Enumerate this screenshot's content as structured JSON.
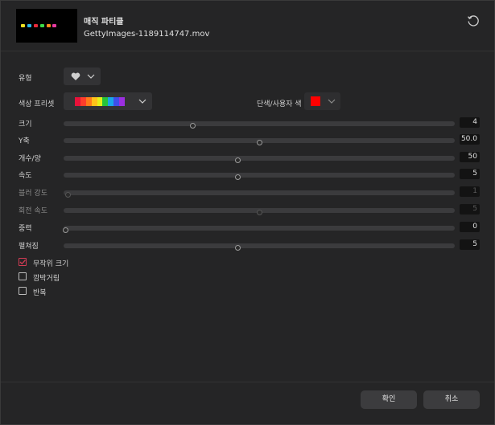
{
  "header": {
    "title": "매직 파티클",
    "filename": "GettyImages-1189114747.mov"
  },
  "type_row": {
    "label": "유형",
    "selected_icon": "heart-icon"
  },
  "preset_row": {
    "label": "색상 프리셋",
    "colors": [
      "#e8123a",
      "#ff3d2b",
      "#ff7a1a",
      "#ffc21a",
      "#e3f01a",
      "#27c43b",
      "#1aa6e8",
      "#3f4fe8",
      "#9b2fe0"
    ],
    "mono_label": "단색/사용자 색",
    "mono_color": "#ff0000"
  },
  "sliders": [
    {
      "label": "크기",
      "value": "4",
      "fraction": 0.33,
      "enabled": true
    },
    {
      "label": "Y축",
      "value": "50.0",
      "fraction": 0.5,
      "enabled": true
    },
    {
      "label": "개수/양",
      "value": "50",
      "fraction": 0.445,
      "enabled": true
    },
    {
      "label": "속도",
      "value": "5",
      "fraction": 0.445,
      "enabled": true
    },
    {
      "label": "블러 강도",
      "value": "1",
      "fraction": 0.01,
      "enabled": false
    },
    {
      "label": "회전 속도",
      "value": "5",
      "fraction": 0.5,
      "enabled": false
    },
    {
      "label": "중력",
      "value": "0",
      "fraction": 0.005,
      "enabled": true
    },
    {
      "label": "펼쳐짐",
      "value": "5",
      "fraction": 0.445,
      "enabled": true
    }
  ],
  "checkboxes": [
    {
      "label": "무작위 크기",
      "checked": true
    },
    {
      "label": "깜박거림",
      "checked": false
    },
    {
      "label": "반복",
      "checked": false
    }
  ],
  "footer": {
    "ok_label": "확인",
    "cancel_label": "취소"
  }
}
